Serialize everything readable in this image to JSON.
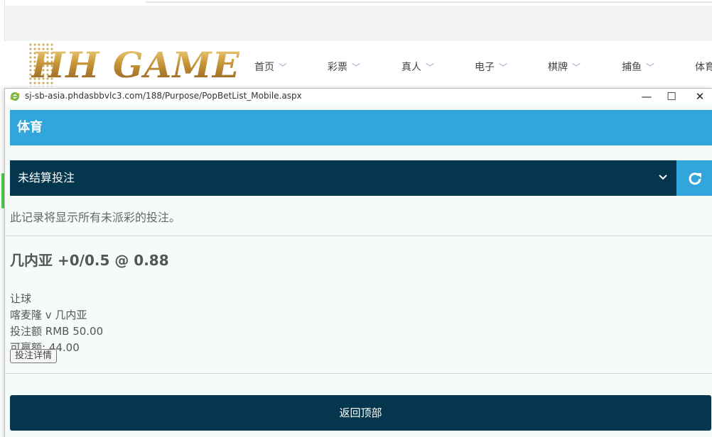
{
  "background_site": {
    "logo_text": "HH GAME",
    "nav": [
      {
        "label": "首页"
      },
      {
        "label": "彩票"
      },
      {
        "label": "真人"
      },
      {
        "label": "电子"
      },
      {
        "label": "棋牌"
      },
      {
        "label": "捕鱼"
      },
      {
        "label": "体育"
      }
    ]
  },
  "window": {
    "url": "sj-sb-asia.phdasbbvlc3.com/188/Purpose/PopBetList_Mobile.aspx",
    "minimize": "—",
    "maximize": "☐",
    "close": "✕"
  },
  "page": {
    "section_title": "体育",
    "filter": {
      "selected": "未结算投注"
    },
    "note": "此记录将显示所有未派彩的投注。",
    "bet": {
      "selection": "几内亚 +0/0.5 @ 0.88",
      "market": "让球",
      "match": "喀麦隆 v 几内亚",
      "stake": "投注额 RMB 50.00",
      "potential_win": "可赢额: 44.00",
      "details_button": "投注详情"
    },
    "back_to_top": "返回顶部"
  },
  "colors": {
    "accent_blue": "#33a5dd",
    "dark_navy": "#04364e",
    "content_bg": "#f5fcf8",
    "logo_gold": "#c8973b"
  }
}
